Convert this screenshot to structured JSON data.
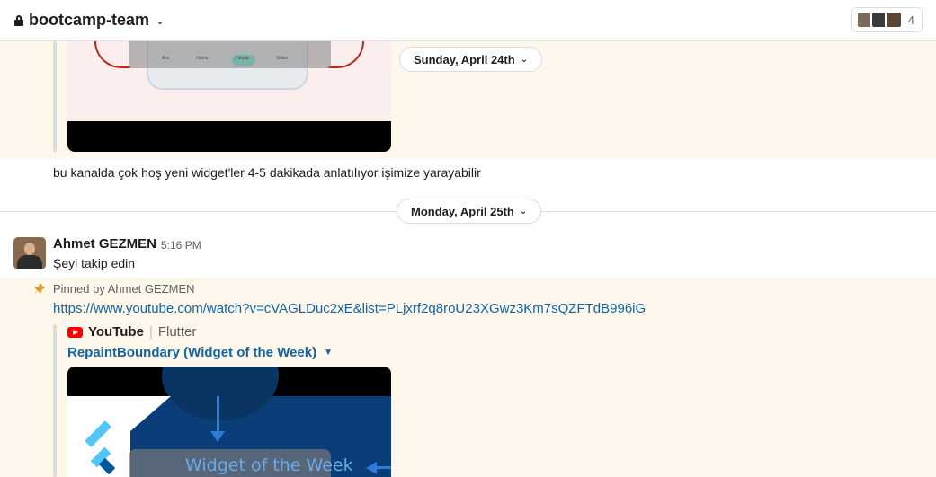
{
  "header": {
    "channel_name": "bootcamp-team",
    "member_count": "4"
  },
  "dates": {
    "first": "Sunday, April 24th",
    "second": "Monday, April 25th"
  },
  "thumbnail1": {
    "nav_items": [
      "Ara",
      "Home",
      "Hesap",
      "Video"
    ]
  },
  "messages": {
    "prev_text": "bu kanalda çok hoş yeni widget'ler 4-5 dakikada anlatılıyor işimize yarayabilir",
    "sender": "Ahmet GEZMEN",
    "time": "5:16 PM",
    "text": "Şeyi takip edin",
    "pinned_by": "Pinned by Ahmet GEZMEN",
    "link": "https://www.youtube.com/watch?v=cVAGLDuc2xE&list=PLjxrf2q8roU23XGwz3Km7sQZFTdB996iG"
  },
  "embed": {
    "provider": "YouTube",
    "author": "Flutter",
    "title": "RepaintBoundary (Widget of the Week)",
    "thumbnail_text": "Widget of the Week"
  }
}
